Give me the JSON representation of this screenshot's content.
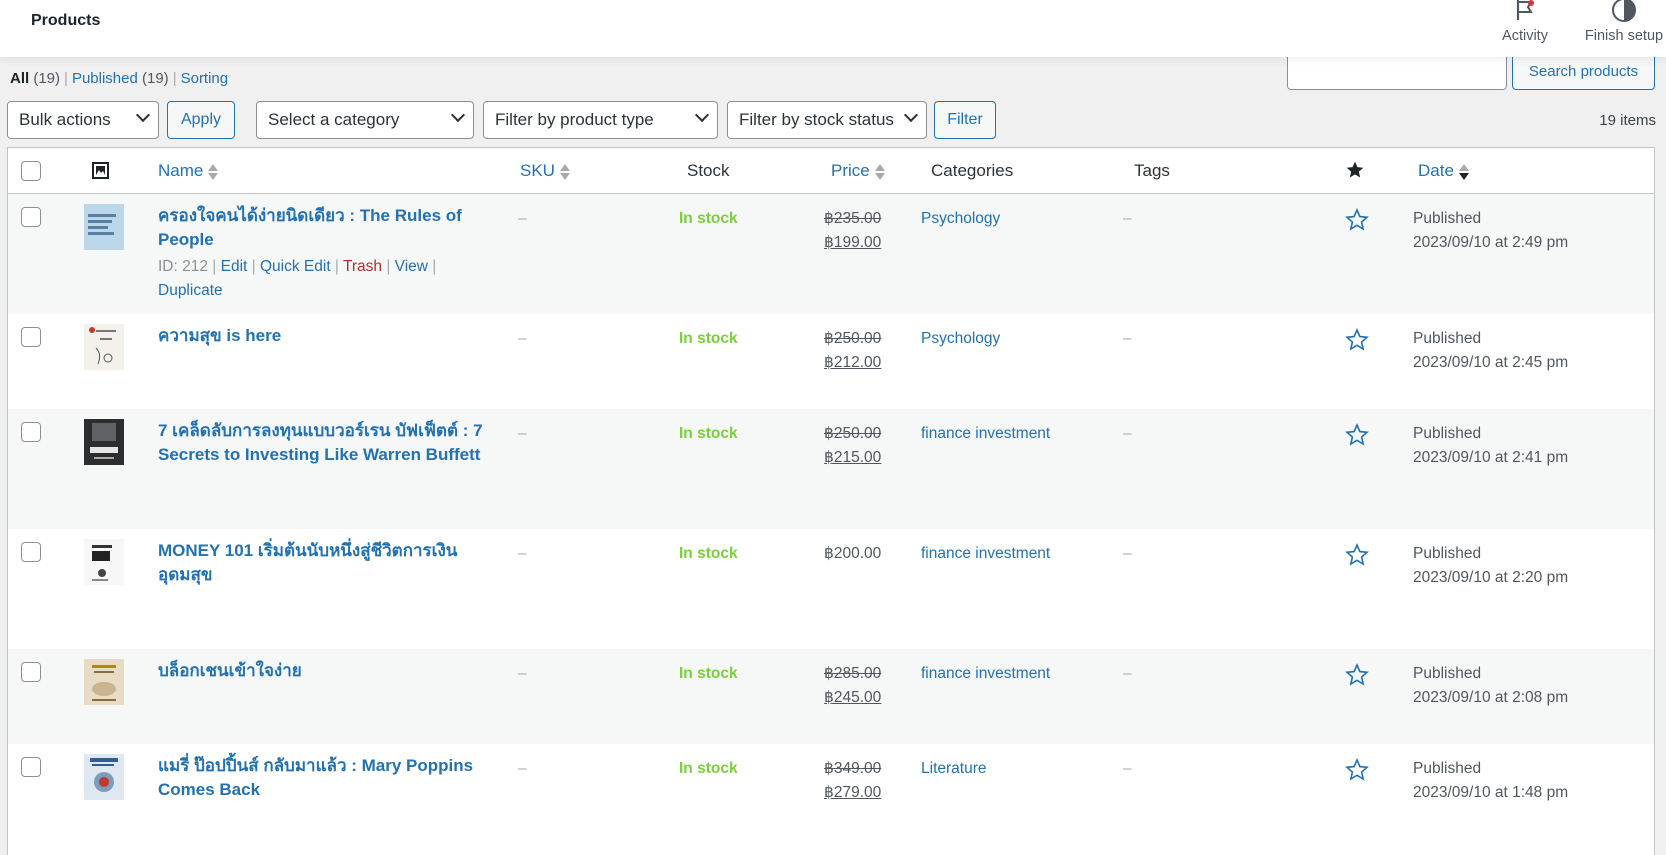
{
  "header": {
    "title": "Products",
    "activity_label": "Activity",
    "finish_setup_label": "Finish setup"
  },
  "views": {
    "all_label": "All",
    "all_count": "(19)",
    "published_label": "Published",
    "published_count": "(19)",
    "sorting_label": "Sorting"
  },
  "search": {
    "value": "",
    "button_label": "Search products"
  },
  "tablenav": {
    "bulk_actions": "Bulk actions",
    "apply_label": "Apply",
    "category_select": "Select a category",
    "product_type_select": "Filter by product type",
    "stock_status_select": "Filter by stock status",
    "filter_label": "Filter",
    "items_count": "19 items"
  },
  "columns": {
    "name": "Name",
    "sku": "SKU",
    "stock": "Stock",
    "price": "Price",
    "categories": "Categories",
    "tags": "Tags",
    "date": "Date"
  },
  "row_actions": {
    "id": "ID: 212",
    "edit": "Edit",
    "quick_edit": "Quick Edit",
    "trash": "Trash",
    "view": "View",
    "duplicate": "Duplicate"
  },
  "products": [
    {
      "name": "ครองใจคนได้ง่ายนิดเดียว : The Rules of People",
      "sku": "–",
      "stock": "In stock",
      "price_old": "฿235.00",
      "price_new": "฿199.00",
      "category": "Psychology",
      "tags": "–",
      "status": "Published",
      "date": "2023/09/10 at 2:49 pm",
      "thumb_color": "#bcd6ea"
    },
    {
      "name": "ความสุข is here",
      "sku": "–",
      "stock": "In stock",
      "price_old": "฿250.00",
      "price_new": "฿212.00",
      "category": "Psychology",
      "tags": "–",
      "status": "Published",
      "date": "2023/09/10 at 2:45 pm",
      "thumb_color": "#f4f1ec"
    },
    {
      "name": "7 เคล็ดลับการลงทุนแบบวอร์เรน บัฟเฟ็ตต์ : 7 Secrets to Investing Like Warren Buffett",
      "sku": "–",
      "stock": "In stock",
      "price_old": "฿250.00",
      "price_new": "฿215.00",
      "category": "finance investment",
      "tags": "–",
      "status": "Published",
      "date": "2023/09/10 at 2:41 pm",
      "thumb_color": "#2b2d2f"
    },
    {
      "name": "MONEY 101 เริ่มต้นนับหนึ่งสู่ชีวิตการเงินอุดมสุข",
      "sku": "–",
      "stock": "In stock",
      "price_old": "",
      "price_new": "฿200.00",
      "category": "finance investment",
      "tags": "–",
      "status": "Published",
      "date": "2023/09/10 at 2:20 pm",
      "thumb_color": "#f7f7f7"
    },
    {
      "name": "บล็อกเชนเข้าใจง่าย",
      "sku": "–",
      "stock": "In stock",
      "price_old": "฿285.00",
      "price_new": "฿245.00",
      "category": "finance investment",
      "tags": "–",
      "status": "Published",
      "date": "2023/09/10 at 2:08 pm",
      "thumb_color": "#e8dcc6"
    },
    {
      "name": "แมรี่ ป๊อปปิ้นส์ กลับมาแล้ว : Mary Poppins Comes Back",
      "sku": "–",
      "stock": "In stock",
      "price_old": "฿349.00",
      "price_new": "฿279.00",
      "category": "Literature",
      "tags": "–",
      "status": "Published",
      "date": "2023/09/10 at 1:48 pm",
      "thumb_color": "#dfe8f0"
    }
  ]
}
